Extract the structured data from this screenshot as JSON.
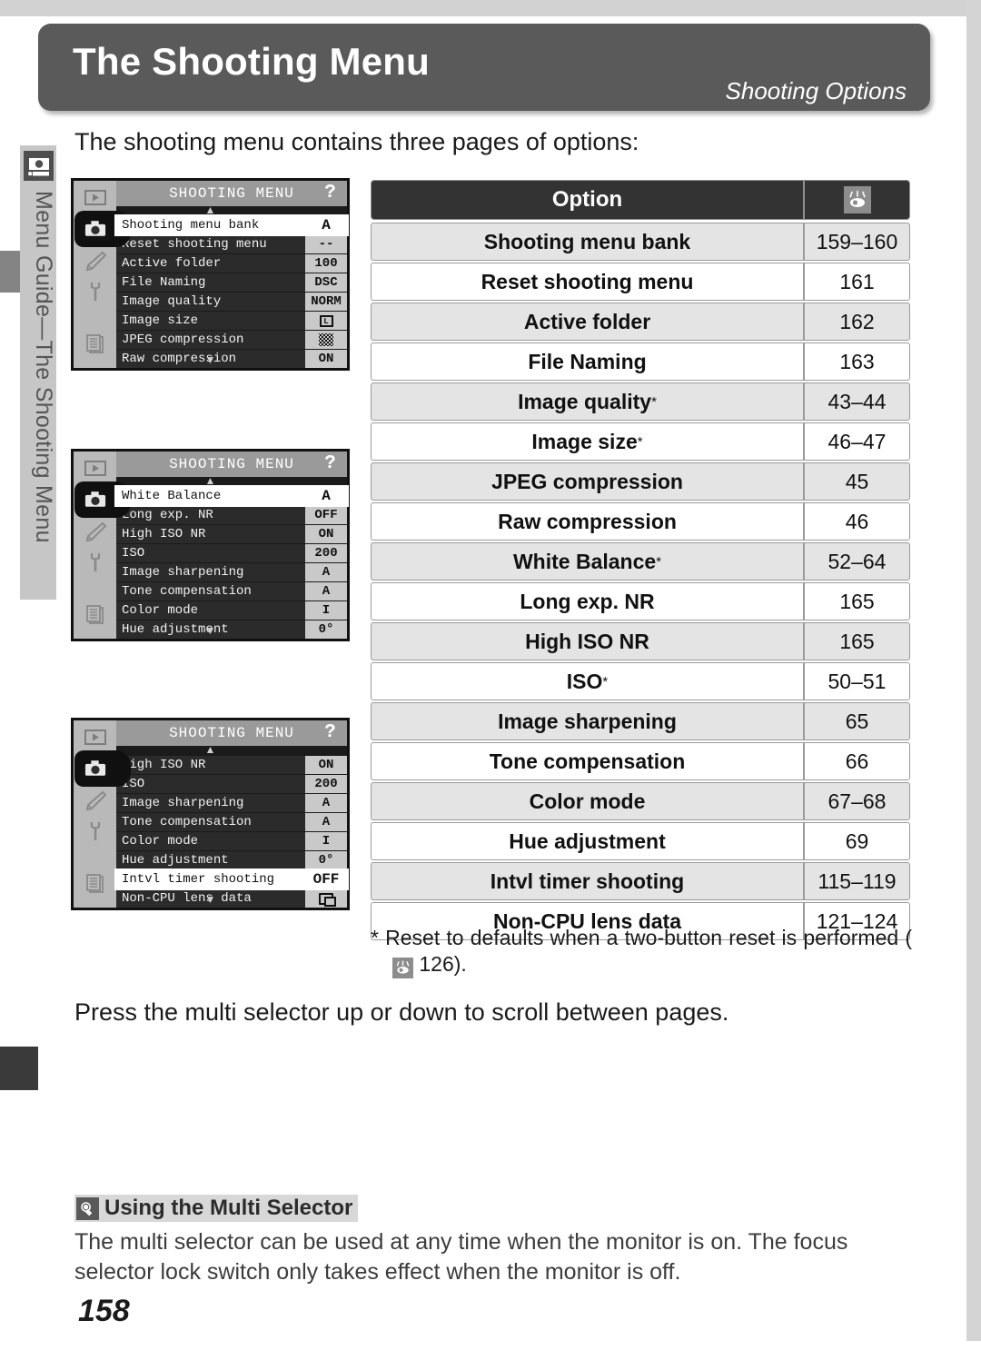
{
  "header": {
    "title": "The Shooting Menu",
    "subtitle": "Shooting Options"
  },
  "sidebar": {
    "label": "Menu Guide—The Shooting Menu",
    "icon": "camera-icon"
  },
  "intro": "The shooting menu contains three pages of options:",
  "scroll_note": "Press the multi selector up or down to scroll between pages.",
  "lcd_screens": [
    {
      "title": "SHOOTING MENU",
      "help_glyph": "?",
      "side_icons": [
        "playback-icon",
        "camera-icon",
        "pencil-icon",
        "wrench-icon",
        "pages-icon"
      ],
      "arrow_up": "▲",
      "arrow_down": "▼",
      "rows": [
        {
          "label": "Shooting menu bank",
          "value": "A",
          "selected": true,
          "value_icon": null
        },
        {
          "label": "Reset shooting menu",
          "value": "--",
          "selected": false,
          "value_icon": null
        },
        {
          "label": "Active folder",
          "value": "100",
          "selected": false,
          "value_icon": null
        },
        {
          "label": "File Naming",
          "value": "DSC",
          "selected": false,
          "value_icon": null
        },
        {
          "label": "Image quality",
          "value": "NORM",
          "selected": false,
          "value_icon": null
        },
        {
          "label": "Image size",
          "value": "L",
          "selected": false,
          "value_icon": "image-size-large-icon"
        },
        {
          "label": "JPEG compression",
          "value": "",
          "selected": false,
          "value_icon": "jpeg-compression-icon"
        },
        {
          "label": "Raw compression",
          "value": "ON",
          "selected": false,
          "value_icon": null
        }
      ]
    },
    {
      "title": "SHOOTING MENU",
      "help_glyph": "?",
      "side_icons": [
        "playback-icon",
        "camera-icon",
        "pencil-icon",
        "wrench-icon",
        "pages-icon"
      ],
      "arrow_up": "▲",
      "arrow_down": "▼",
      "rows": [
        {
          "label": "White Balance",
          "value": "A",
          "selected": true,
          "value_icon": null
        },
        {
          "label": "Long exp. NR",
          "value": "OFF",
          "selected": false,
          "value_icon": null
        },
        {
          "label": "High ISO NR",
          "value": "ON",
          "selected": false,
          "value_icon": null
        },
        {
          "label": "ISO",
          "value": "200",
          "selected": false,
          "value_icon": null
        },
        {
          "label": "Image sharpening",
          "value": "A",
          "selected": false,
          "value_icon": null
        },
        {
          "label": "Tone compensation",
          "value": "A",
          "selected": false,
          "value_icon": null
        },
        {
          "label": "Color mode",
          "value": "I",
          "selected": false,
          "value_icon": null
        },
        {
          "label": "Hue adjustment",
          "value": "0°",
          "selected": false,
          "value_icon": null
        }
      ]
    },
    {
      "title": "SHOOTING MENU",
      "help_glyph": "?",
      "side_icons": [
        "playback-icon",
        "camera-icon",
        "pencil-icon",
        "wrench-icon",
        "pages-icon"
      ],
      "arrow_up": "▲",
      "arrow_down": "▼",
      "rows": [
        {
          "label": "High ISO NR",
          "value": "ON",
          "selected": false,
          "value_icon": null
        },
        {
          "label": "ISO",
          "value": "200",
          "selected": false,
          "value_icon": null
        },
        {
          "label": "Image sharpening",
          "value": "A",
          "selected": false,
          "value_icon": null
        },
        {
          "label": "Tone compensation",
          "value": "A",
          "selected": false,
          "value_icon": null
        },
        {
          "label": "Color mode",
          "value": "I",
          "selected": false,
          "value_icon": null
        },
        {
          "label": "Hue adjustment",
          "value": "0°",
          "selected": false,
          "value_icon": null
        },
        {
          "label": "Intvl timer shooting",
          "value": "OFF",
          "selected": true,
          "value_icon": null
        },
        {
          "label": "Non-CPU lens data",
          "value": "",
          "selected": false,
          "value_icon": "non-cpu-lens-icon"
        }
      ]
    }
  ],
  "table": {
    "header": {
      "option_label": "Option",
      "page_icon": "eye-reference-icon"
    },
    "rows": [
      {
        "option": "Shooting menu bank",
        "asterisk": false,
        "pages": "159–160"
      },
      {
        "option": "Reset shooting menu",
        "asterisk": false,
        "pages": "161"
      },
      {
        "option": "Active folder",
        "asterisk": false,
        "pages": "162"
      },
      {
        "option": "File Naming",
        "asterisk": false,
        "pages": "163"
      },
      {
        "option": "Image quality",
        "asterisk": true,
        "pages": "43–44"
      },
      {
        "option": "Image size",
        "asterisk": true,
        "pages": "46–47"
      },
      {
        "option": "JPEG compression",
        "asterisk": false,
        "pages": "45"
      },
      {
        "option": "Raw compression",
        "asterisk": false,
        "pages": "46"
      },
      {
        "option": "White Balance",
        "asterisk": true,
        "pages": "52–64"
      },
      {
        "option": "Long exp. NR",
        "asterisk": false,
        "pages": "165"
      },
      {
        "option": "High ISO NR",
        "asterisk": false,
        "pages": "165"
      },
      {
        "option": "ISO",
        "asterisk": true,
        "pages": "50–51"
      },
      {
        "option": "Image sharpening",
        "asterisk": false,
        "pages": "65"
      },
      {
        "option": "Tone compensation",
        "asterisk": false,
        "pages": "66"
      },
      {
        "option": "Color mode",
        "asterisk": false,
        "pages": "67–68"
      },
      {
        "option": "Hue adjustment",
        "asterisk": false,
        "pages": "69"
      },
      {
        "option": "Intvl timer shooting",
        "asterisk": false,
        "pages": "115–119"
      },
      {
        "option": "Non-CPU lens data",
        "asterisk": false,
        "pages": "121–124"
      }
    ]
  },
  "footnote": {
    "marker": "*",
    "text_before": "Reset to defaults when a two-button reset is performed (",
    "reference_icon": "eye-reference-icon",
    "page": "126",
    "text_after": ")."
  },
  "tip": {
    "icon": "tip-bulb-icon",
    "title": "Using the Multi Selector",
    "body": "The multi selector can be used at any time when the monitor is on.  The focus selector lock switch only takes effect when the monitor is off."
  },
  "page_number": "158",
  "colors": {
    "header_bg": "#5a5a5a",
    "table_header_bg": "#333333",
    "row_shade": "#e4e4e4",
    "sidebar_bg": "#c6c6c6",
    "lcd_bg": "#1b1b1b"
  }
}
